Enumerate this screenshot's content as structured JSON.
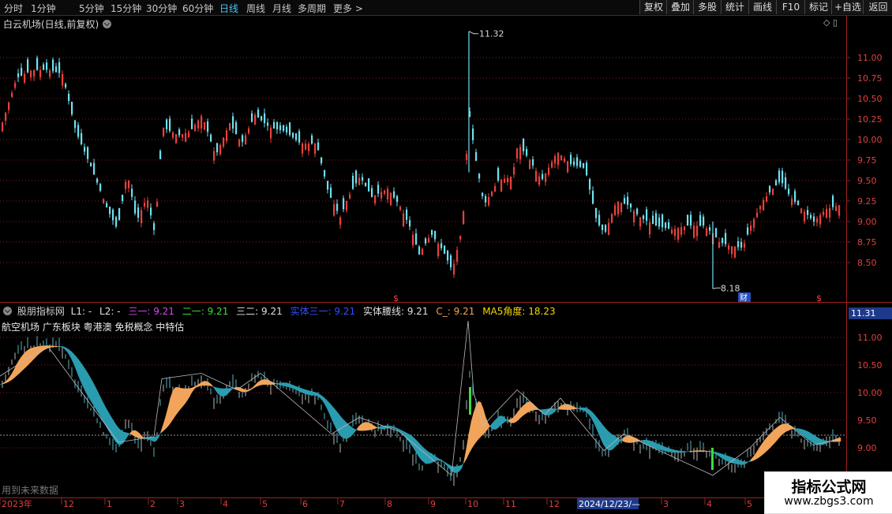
{
  "toolbar": {
    "periods": [
      "分时",
      "1分钟",
      "5分钟",
      "15分钟",
      "30分钟",
      "60分钟",
      "日线",
      "周线",
      "月线",
      "多周期",
      "更多 >"
    ],
    "active_period": "日线",
    "buttons": [
      "复权",
      "叠加",
      "多股",
      "统计",
      "画线",
      "F10",
      "标记",
      "+自选",
      "返回"
    ]
  },
  "stock_title": "白云机场(日线,前复权)",
  "window_controls": "◇ ▯",
  "price_axis": [
    "11.00",
    "10.75",
    "10.50",
    "10.25",
    "10.00",
    "9.75",
    "9.50",
    "9.25",
    "9.00",
    "8.75",
    "8.50"
  ],
  "high_label": "11.32",
  "low_label": "8.18",
  "marker_cai": "财",
  "marker_s": "$",
  "indicator": {
    "name": "股朋指标网",
    "l1": "L1: -",
    "l2": "L2: -",
    "s31": "三一: 9.21",
    "s21": "二一: 9.21",
    "s32": "三二: 9.21",
    "solid31": "实体三一: 9.21",
    "waist": "实体腰线: 9.21",
    "c": "C_: 9.21",
    "ma5": "MA5角度: 18.23",
    "colors": {
      "name": "#d0d0d0",
      "l1": "#e0e0e0",
      "l2": "#e0e0e0",
      "s31": "#d946ef",
      "s21": "#3ddc3d",
      "s32": "#e0e0e0",
      "solid31": "#3050ff",
      "waist": "#e0e0e0",
      "c": "#f2a55a",
      "ma5": "#f5d700"
    }
  },
  "concept_text": "航空机场 广东板块 粤港澳 免税概念 中特估",
  "future_text": "用到未来数据",
  "indicator_axis": [
    "11.00",
    "10.50",
    "10.00",
    "9.50",
    "9.00"
  ],
  "current_price_tag": "11.31",
  "time_axis": [
    "2023年",
    "12",
    "1",
    "2",
    "3",
    "4",
    "5",
    "6",
    "7",
    "8",
    "9",
    "10",
    "11",
    "12",
    "2024/12/23/—",
    "3",
    "4",
    "5"
  ],
  "watermark": {
    "title": "指标公式网",
    "url": "www.zbgs3.com"
  },
  "colors": {
    "up": "#e8413c",
    "down": "#6ee0f0",
    "grid": "#8a1a1a",
    "ribbon_up": "#f2a55a",
    "ribbon_down": "#2a9cb0"
  },
  "chart_data": {
    "type": "candlestick",
    "price_range": [
      8.3,
      11.35
    ],
    "high": 11.32,
    "low": 8.18
  }
}
